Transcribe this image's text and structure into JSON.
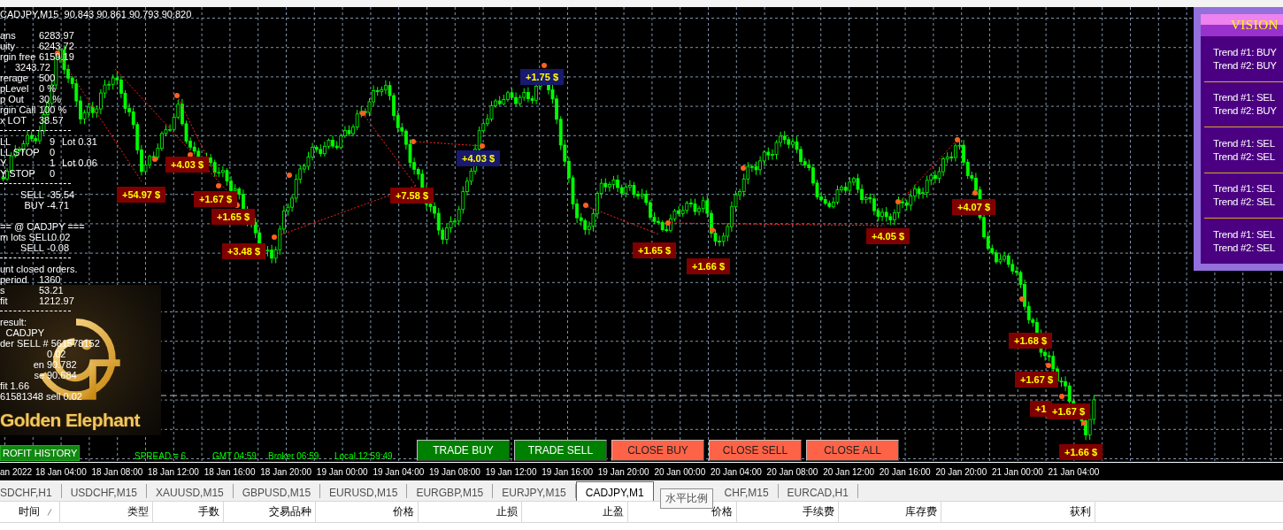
{
  "chart": {
    "title": "CADJPY,M15  90.843 90.861 90.793 90.820",
    "info_lines": [
      {
        "kind": "pair",
        "label": "ans",
        "value": "6283.97"
      },
      {
        "kind": "pair",
        "label": "uity",
        "value": "6243.72"
      },
      {
        "kind": "pair",
        "label": "rgin free",
        "value": "6159.19"
      },
      {
        "kind": "value",
        "value": "3243.72"
      },
      {
        "kind": "pair",
        "label": "rerage",
        "value": "500"
      },
      {
        "kind": "pair",
        "label": "pLevel",
        "value": "0 %"
      },
      {
        "kind": "pair",
        "label": "p Out",
        "value": "30 %"
      },
      {
        "kind": "pair",
        "label": "rgin Call",
        "value": "100 %"
      },
      {
        "kind": "pair",
        "label": "x LOT",
        "value": "38.57"
      },
      {
        "kind": "divider"
      },
      {
        "kind": "count",
        "label": "LL",
        "value": "9",
        "extra": "Lot  0.31"
      },
      {
        "kind": "count",
        "label": "LL STOP",
        "value": "0"
      },
      {
        "kind": "count",
        "label": "Y",
        "value": "1",
        "extra": "Lot  0.06"
      },
      {
        "kind": "count",
        "label": "Y STOP",
        "value": "0"
      },
      {
        "kind": "divider"
      },
      {
        "kind": "order",
        "label": "SELL",
        "value": "-35.54"
      },
      {
        "kind": "order",
        "label": "BUY",
        "value": "-4.71"
      },
      {
        "kind": "heading",
        "label": "==  @  CADJPY  ==="
      },
      {
        "kind": "pair",
        "label": "m lots SELL",
        "value": "0.02"
      },
      {
        "kind": "order",
        "label": "SELL",
        "value": "-0.08"
      },
      {
        "kind": "divider"
      },
      {
        "kind": "text",
        "label": "unt closed orders."
      },
      {
        "kind": "pair",
        "label": "period",
        "value": "1360"
      },
      {
        "kind": "pair",
        "label": "s",
        "value": "53.21"
      },
      {
        "kind": "pair",
        "label": "fit",
        "value": "1212.97"
      },
      {
        "kind": "divider"
      },
      {
        "kind": "text",
        "label": "result:"
      },
      {
        "kind": "order",
        "label": "CADJPY"
      },
      {
        "kind": "text",
        "label": "der  SELL  # 561578152"
      },
      {
        "kind": "order",
        "value": "0.02"
      },
      {
        "kind": "order",
        "label": "en",
        "value": "90.782"
      },
      {
        "kind": "order",
        "label": "se",
        "value": "90.684"
      },
      {
        "kind": "text",
        "label": "fit  1.66"
      },
      {
        "kind": "text",
        "label": "61581348 sell 0.02"
      }
    ],
    "logo_text": "Golden Elephant",
    "history_button": "ROFIT HISTORY",
    "status": [
      "SPREAD = 6",
      "GMT 04:59",
      "Broker 06:59",
      "Local 12:59:49"
    ],
    "trade_buttons": [
      {
        "label": "TRADE BUY",
        "color": "#008000"
      },
      {
        "label": "TRADE SELL",
        "color": "#008000"
      },
      {
        "label": "CLOSE BUY",
        "color": "#ff6347"
      },
      {
        "label": "CLOSE SELL",
        "color": "#ff6347"
      },
      {
        "label": "CLOSE ALL",
        "color": "#ff6347"
      }
    ],
    "profit_labels": [
      {
        "text": "+54.97 $",
        "color": "#800000"
      },
      {
        "text": "+4.03 $",
        "color": "#800000"
      },
      {
        "text": "+1.67 $",
        "color": "#800000"
      },
      {
        "text": "+1.65 $",
        "color": "#800000"
      },
      {
        "text": "+3.48 $",
        "color": "#800000"
      },
      {
        "text": "+7.58 $",
        "color": "#800000"
      },
      {
        "text": "+4.03 $",
        "color": "#191970"
      },
      {
        "text": "+1.75 $",
        "color": "#191970"
      },
      {
        "text": "+1.65 $",
        "color": "#800000"
      },
      {
        "text": "+1.66 $",
        "color": "#800000"
      },
      {
        "text": "+4.05 $",
        "color": "#800000"
      },
      {
        "text": "+4.07 $",
        "color": "#800000"
      },
      {
        "text": "+1.68 $",
        "color": "#800000"
      },
      {
        "text": "+1.67 $",
        "color": "#800000"
      },
      {
        "text": "+1",
        "color": "#800000"
      },
      {
        "text": "+1.67 $",
        "color": "#800000"
      },
      {
        "text": "+1.66 $",
        "color": "#800000"
      }
    ],
    "time_axis": [
      "an 2022",
      "18 Jan 04:00",
      "18 Jan 08:00",
      "18 Jan 12:00",
      "18 Jan 16:00",
      "18 Jan 20:00",
      "19 Jan 00:00",
      "19 Jan 04:00",
      "19 Jan 08:00",
      "19 Jan 12:00",
      "19 Jan 16:00",
      "19 Jan 20:00",
      "20 Jan 00:00",
      "20 Jan 04:00",
      "20 Jan 08:00",
      "20 Jan 12:00",
      "20 Jan 16:00",
      "20 Jan 20:00",
      "21 Jan 00:00",
      "21 Jan 04:00"
    ]
  },
  "vision_panel": {
    "title": "VISION",
    "signals": [
      {
        "trend_1": "Trend #1: BUY",
        "trend_2": "Trend #2: BUY"
      },
      {
        "trend_1": "Trend #1: SEL",
        "trend_2": "Trend #2: BUY"
      },
      {
        "trend_1": "Trend #1: SEL",
        "trend_2": "Trend #2: SEL"
      },
      {
        "trend_1": "Trend #1: SEL",
        "trend_2": "Trend #2: SEL"
      },
      {
        "trend_1": "Trend #1: SEL",
        "trend_2": "Trend #2: SEL"
      }
    ]
  },
  "tabs": [
    {
      "label": "SDCHF,H1",
      "selected": false
    },
    {
      "label": "USDCHF,M15",
      "selected": false
    },
    {
      "label": "XAUUSD,M15",
      "selected": false
    },
    {
      "label": "GBPUSD,M15",
      "selected": false
    },
    {
      "label": "EURUSD,M15",
      "selected": false
    },
    {
      "label": "EURGBP,M15",
      "selected": false
    },
    {
      "label": "EURJPY,M15",
      "selected": false
    },
    {
      "label": "CADJPY,M1",
      "selected": true
    },
    {
      "label": "CHF,M15",
      "selected": false
    },
    {
      "label": "EURCAD,H1",
      "selected": false
    }
  ],
  "tooltip": "水平比例",
  "table": {
    "columns": [
      {
        "label": "时间",
        "sorted": true
      },
      {
        "label": "类型",
        "sorted": false
      },
      {
        "label": "手数",
        "sorted": false
      },
      {
        "label": "交易品种",
        "sorted": false
      },
      {
        "label": "价格",
        "sorted": false
      },
      {
        "label": "止损",
        "sorted": false
      },
      {
        "label": "止盈",
        "sorted": false
      },
      {
        "label": "价格",
        "sorted": false
      },
      {
        "label": "手续费",
        "sorted": false
      },
      {
        "label": "库存费",
        "sorted": false
      },
      {
        "label": "获利",
        "sorted": false
      }
    ]
  }
}
